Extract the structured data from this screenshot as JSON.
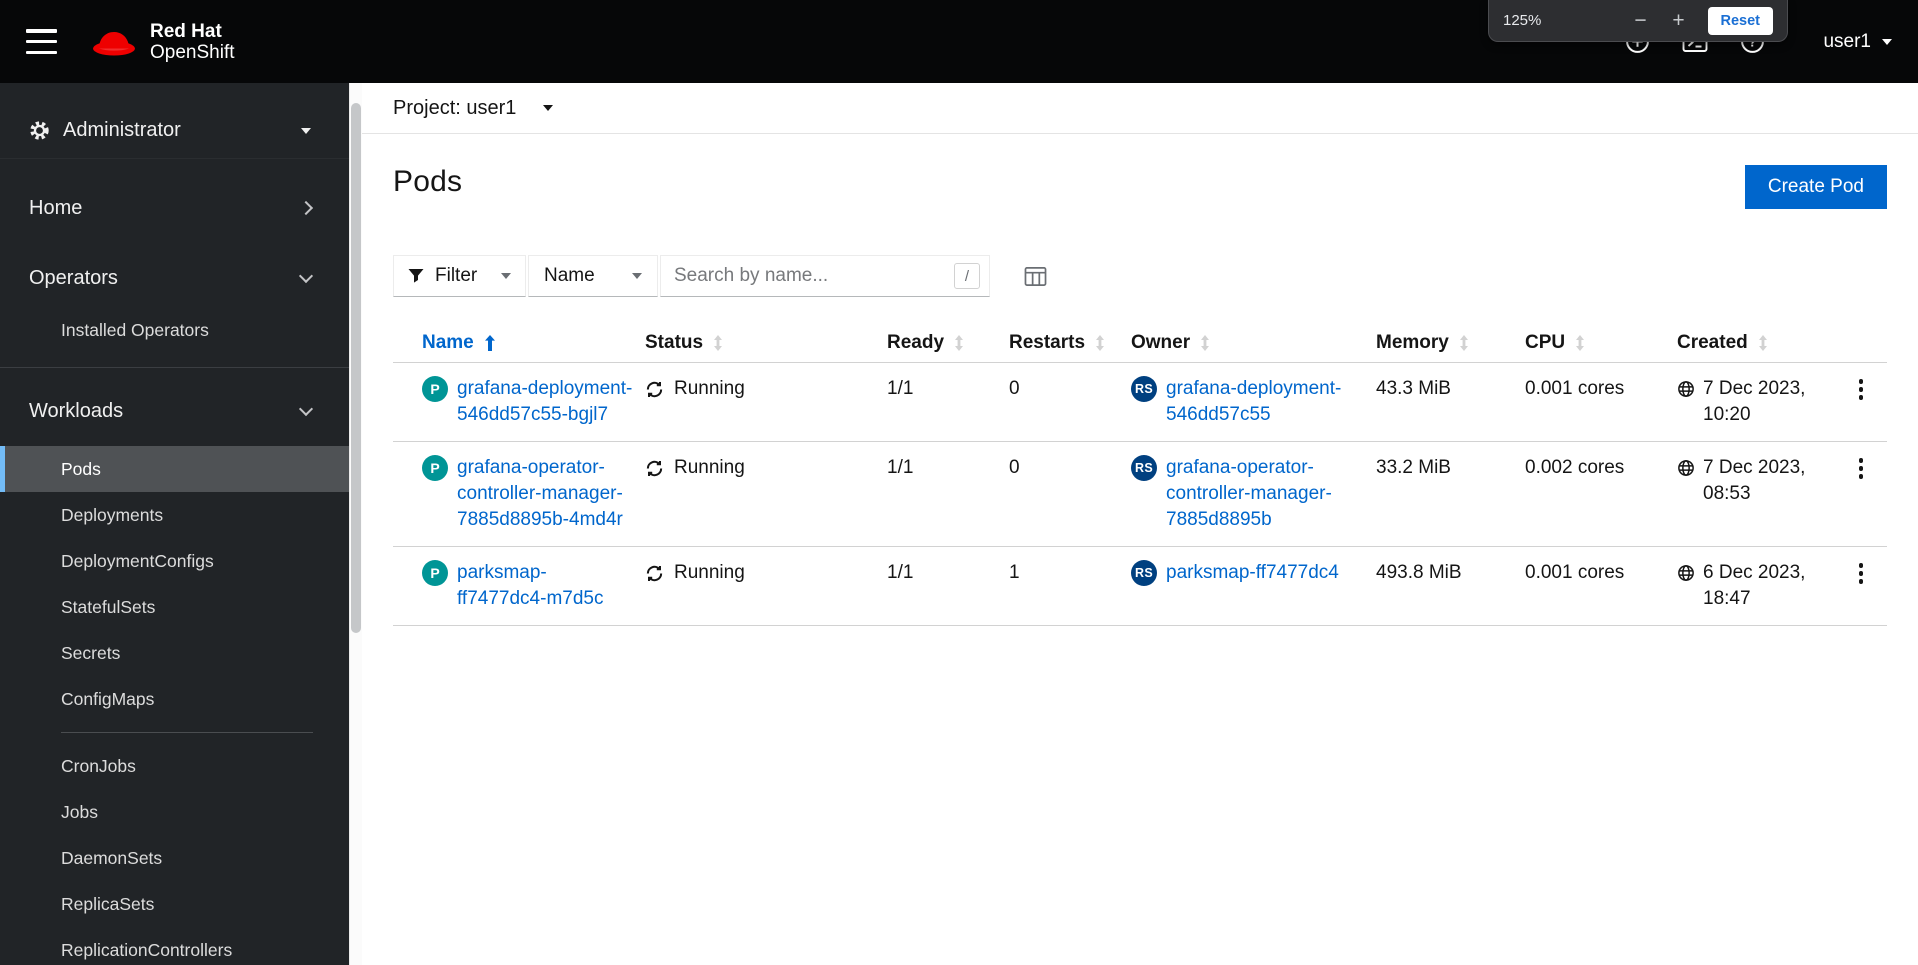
{
  "masthead": {
    "brand": {
      "line1": "Red Hat",
      "line2": "OpenShift"
    },
    "user_menu": {
      "label": "user1"
    },
    "zoom_overlay": {
      "level": "125%",
      "minus_label": "−",
      "plus_label": "+",
      "reset_label": "Reset"
    }
  },
  "sidebar": {
    "perspective": {
      "label": "Administrator"
    },
    "home": {
      "label": "Home",
      "expanded": false
    },
    "operators": {
      "label": "Operators",
      "expanded": true,
      "children": [
        {
          "label": "Installed Operators"
        }
      ]
    },
    "workloads": {
      "label": "Workloads",
      "expanded": true,
      "children": [
        {
          "label": "Pods",
          "selected": true
        },
        {
          "label": "Deployments"
        },
        {
          "label": "DeploymentConfigs"
        },
        {
          "label": "StatefulSets"
        },
        {
          "label": "Secrets"
        },
        {
          "label": "ConfigMaps"
        },
        {
          "label": "CronJobs"
        },
        {
          "label": "Jobs"
        },
        {
          "label": "DaemonSets"
        },
        {
          "label": "ReplicaSets"
        },
        {
          "label": "ReplicationControllers"
        }
      ]
    }
  },
  "project_bar": {
    "label": "Project: user1"
  },
  "page": {
    "title": "Pods",
    "create_button_label": "Create Pod"
  },
  "toolbar": {
    "filter_label": "Filter",
    "name_filter_label": "Name",
    "search_placeholder": "Search by name...",
    "search_shortcut_hint": "/"
  },
  "table": {
    "columns": [
      {
        "label": "Name",
        "sorted": "ascending"
      },
      {
        "label": "Status"
      },
      {
        "label": "Ready"
      },
      {
        "label": "Restarts"
      },
      {
        "label": "Owner"
      },
      {
        "label": "Memory"
      },
      {
        "label": "CPU"
      },
      {
        "label": "Created"
      }
    ],
    "rows": [
      {
        "badge": "P",
        "name": "grafana-deployment-546dd57c55-bgjl7",
        "status": "Running",
        "ready": "1/1",
        "restarts": "0",
        "owner_badge": "RS",
        "owner": "grafana-deployment-546dd57c55",
        "memory": "43.3 MiB",
        "cpu": "0.001 cores",
        "created": "7 Dec 2023, 10:20"
      },
      {
        "badge": "P",
        "name": "grafana-operator-controller-manager-7885d8895b-4md4r",
        "status": "Running",
        "ready": "1/1",
        "restarts": "0",
        "owner_badge": "RS",
        "owner": "grafana-operator-controller-manager-7885d8895b",
        "memory": "33.2 MiB",
        "cpu": "0.002 cores",
        "created": "7 Dec 2023, 08:53"
      },
      {
        "badge": "P",
        "name": "parksmap-ff7477dc4-m7d5c",
        "status": "Running",
        "ready": "1/1",
        "restarts": "1",
        "owner_badge": "RS",
        "owner": "parksmap-ff7477dc4",
        "memory": "493.8 MiB",
        "cpu": "0.001 cores",
        "created": "6 Dec 2023, 18:47"
      }
    ]
  },
  "colors": {
    "accent_blue": "#0066cc",
    "pod_badge": "#009596",
    "replicaset_badge": "#004080",
    "nav_selected_bg": "#4f5255",
    "nav_selected_border": "#73bcf7",
    "masthead_bg": "#060708",
    "sidebar_bg": "#212427",
    "redhat_red": "#ee0000",
    "running_icon": "#151515"
  }
}
